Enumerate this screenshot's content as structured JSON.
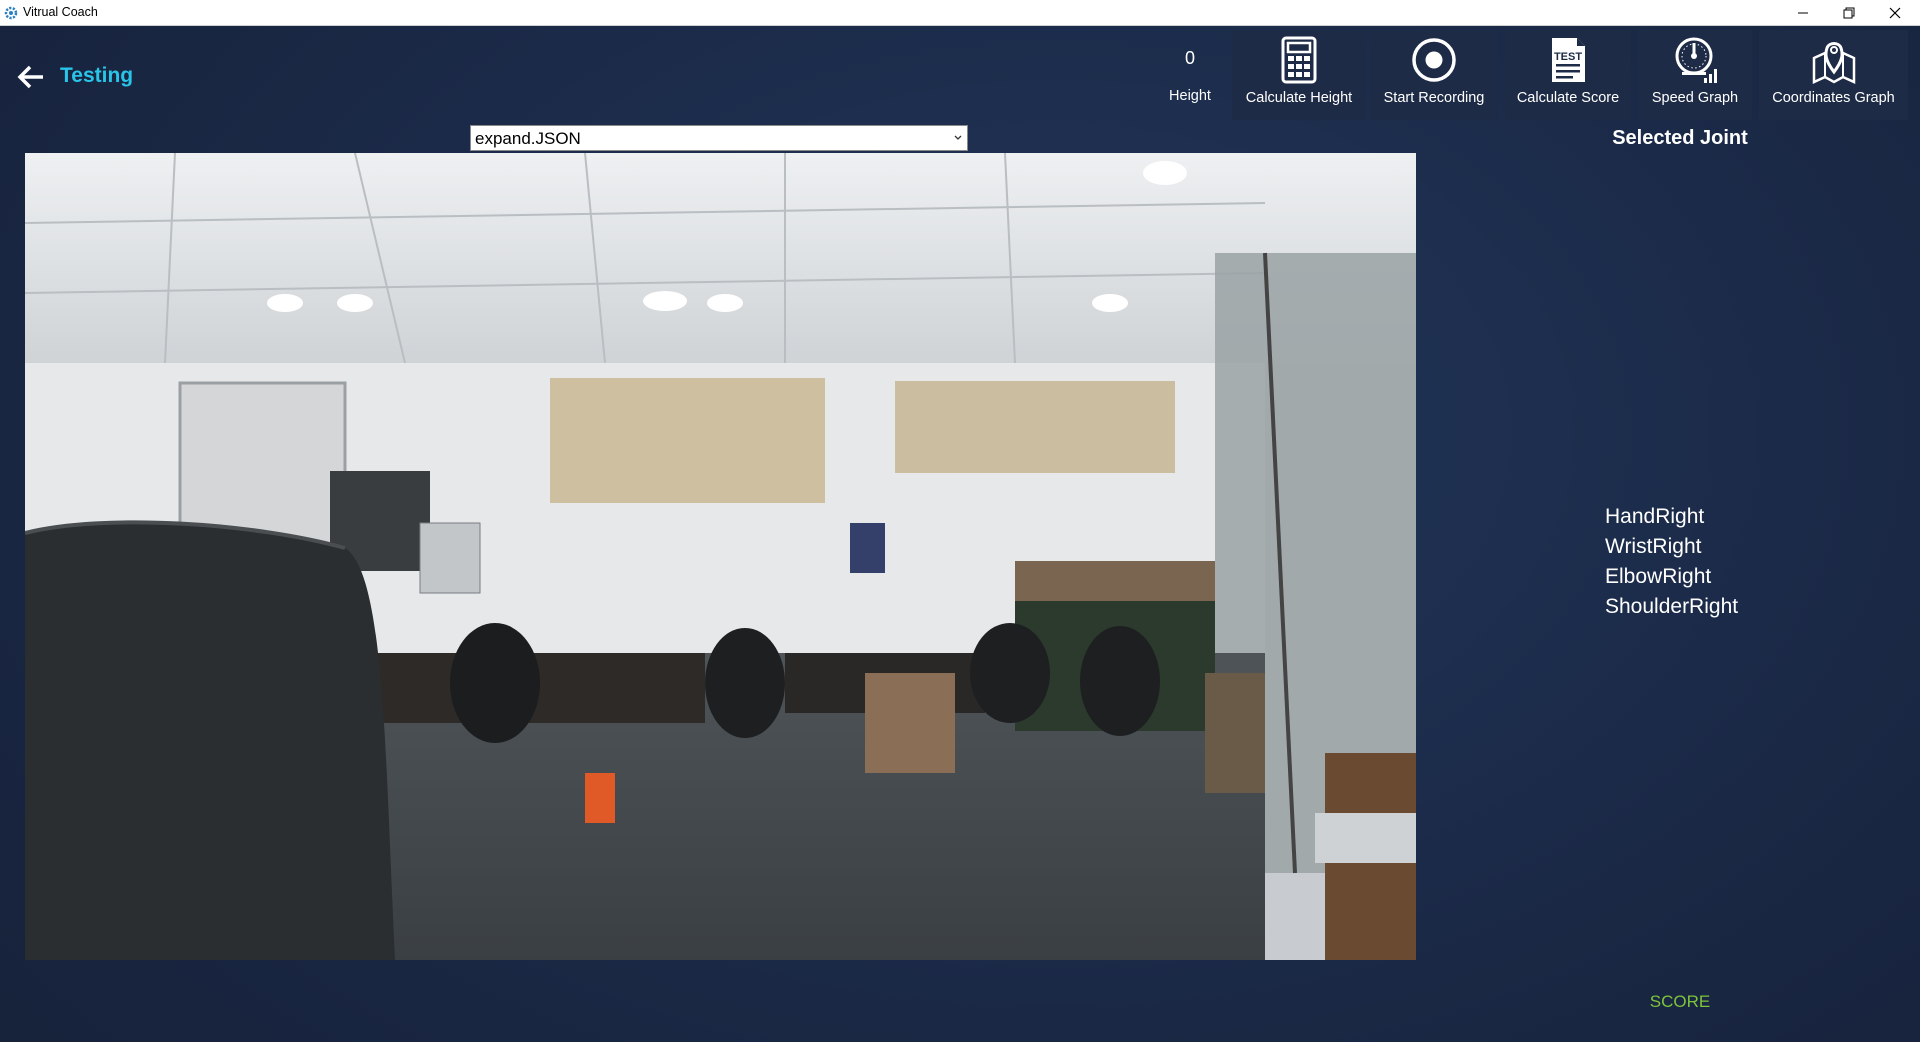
{
  "window": {
    "title": "Vitrual Coach"
  },
  "header": {
    "title": "Testing"
  },
  "height": {
    "value": "0",
    "label": "Height"
  },
  "toolbar": [
    {
      "label": "Calculate Height",
      "icon": "calculator-icon"
    },
    {
      "label": "Start Recording",
      "icon": "record-icon"
    },
    {
      "label": "Calculate Score",
      "icon": "test-document-icon",
      "icon_text": "TEST"
    },
    {
      "label": "Speed Graph",
      "icon": "speedometer-icon"
    },
    {
      "label": "Coordinates Graph",
      "icon": "map-pin-icon"
    }
  ],
  "file_select": {
    "selected": "expand.JSON"
  },
  "camera": {
    "alt": "Live camera feed of an office room"
  },
  "selected_joint": {
    "title": "Selected Joint",
    "joints": [
      "HandRight",
      "WristRight",
      "ElbowRight",
      "ShoulderRight"
    ]
  },
  "score": {
    "label": "SCORE"
  },
  "colors": {
    "accent": "#29c4e8",
    "score": "#7dc43c",
    "background": "#1b2844"
  }
}
